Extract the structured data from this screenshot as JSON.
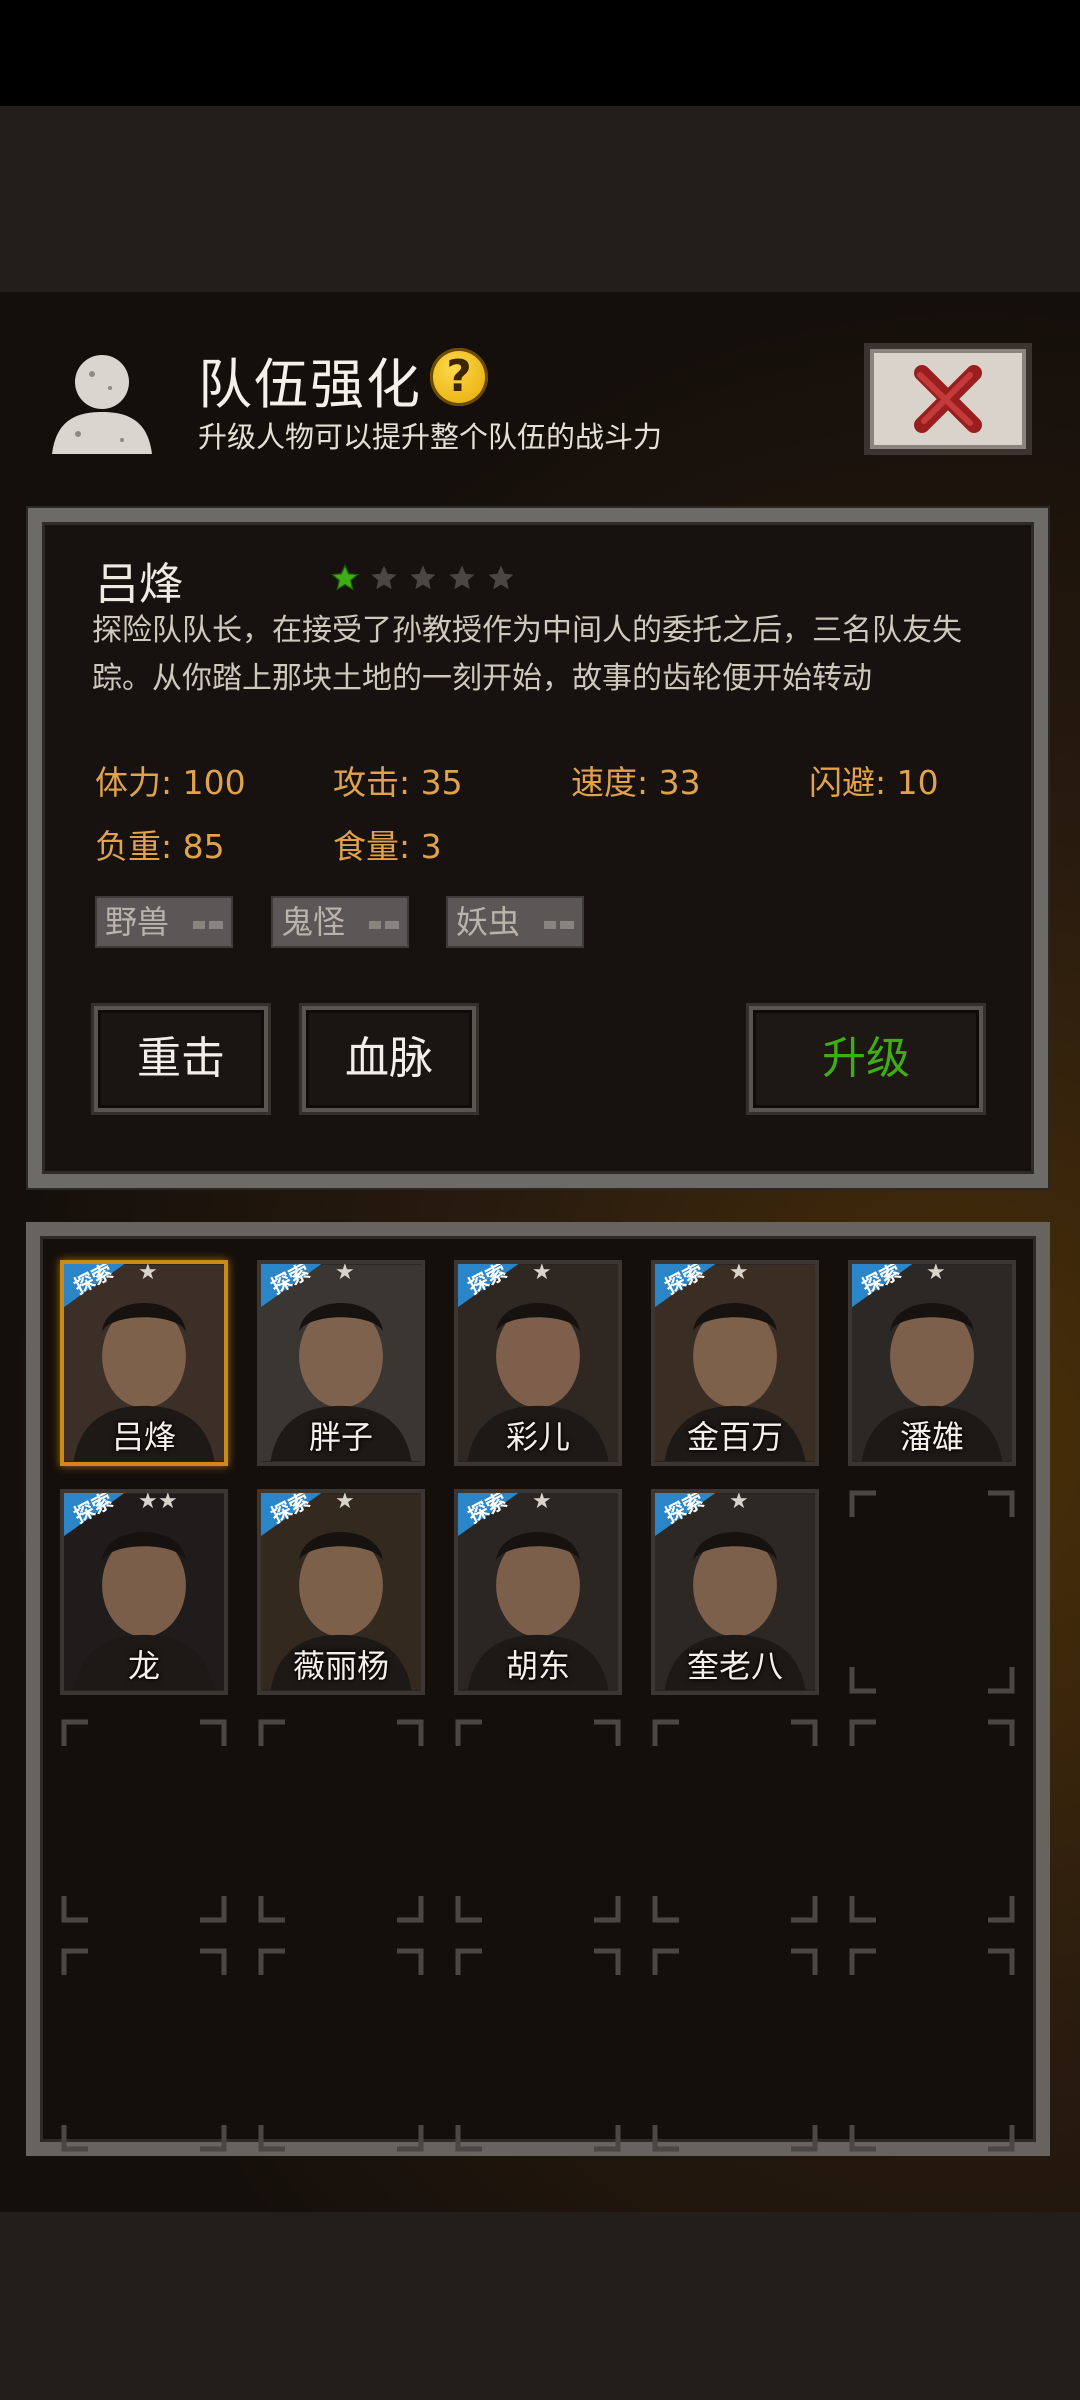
{
  "header": {
    "title": "队伍强化",
    "help_symbol": "?",
    "subtitle": "升级人物可以提升整个队伍的战斗力"
  },
  "character": {
    "name": "吕烽",
    "stars_filled": 1,
    "stars_total": 5,
    "description": "探险队队长，在接受了孙教授作为中间人的委托之后，三名队友失踪。从你踏上那块土地的一刻开始，故事的齿轮便开始转动",
    "stats": {
      "stamina": "体力: 100",
      "attack": "攻击: 35",
      "speed": "速度: 33",
      "dodge": "闪避: 10",
      "load": "负重: 85",
      "food": "食量: 3"
    },
    "tags": [
      "野兽",
      "鬼怪",
      "妖虫"
    ]
  },
  "buttons": {
    "skill_1": "重击",
    "skill_2": "血脉",
    "upgrade": "升级"
  },
  "roster": {
    "badge_text": "探索",
    "members": [
      {
        "name": "吕烽",
        "rank_stars": 1
      },
      {
        "name": "胖子",
        "rank_stars": 1
      },
      {
        "name": "彩儿",
        "rank_stars": 1
      },
      {
        "name": "金百万",
        "rank_stars": 1
      },
      {
        "name": "潘雄",
        "rank_stars": 1
      },
      {
        "name": "龙",
        "rank_stars": 2
      },
      {
        "name": "薇丽杨",
        "rank_stars": 1
      },
      {
        "name": "胡东",
        "rank_stars": 1
      },
      {
        "name": "奎老八",
        "rank_stars": 1
      }
    ]
  },
  "colors": {
    "stat_text": "#e0a24a",
    "upgrade_text": "#3fae16",
    "selected_border": "#c98a1a",
    "badge_blue": "#2a86c8",
    "star_active": "#3fae16"
  }
}
